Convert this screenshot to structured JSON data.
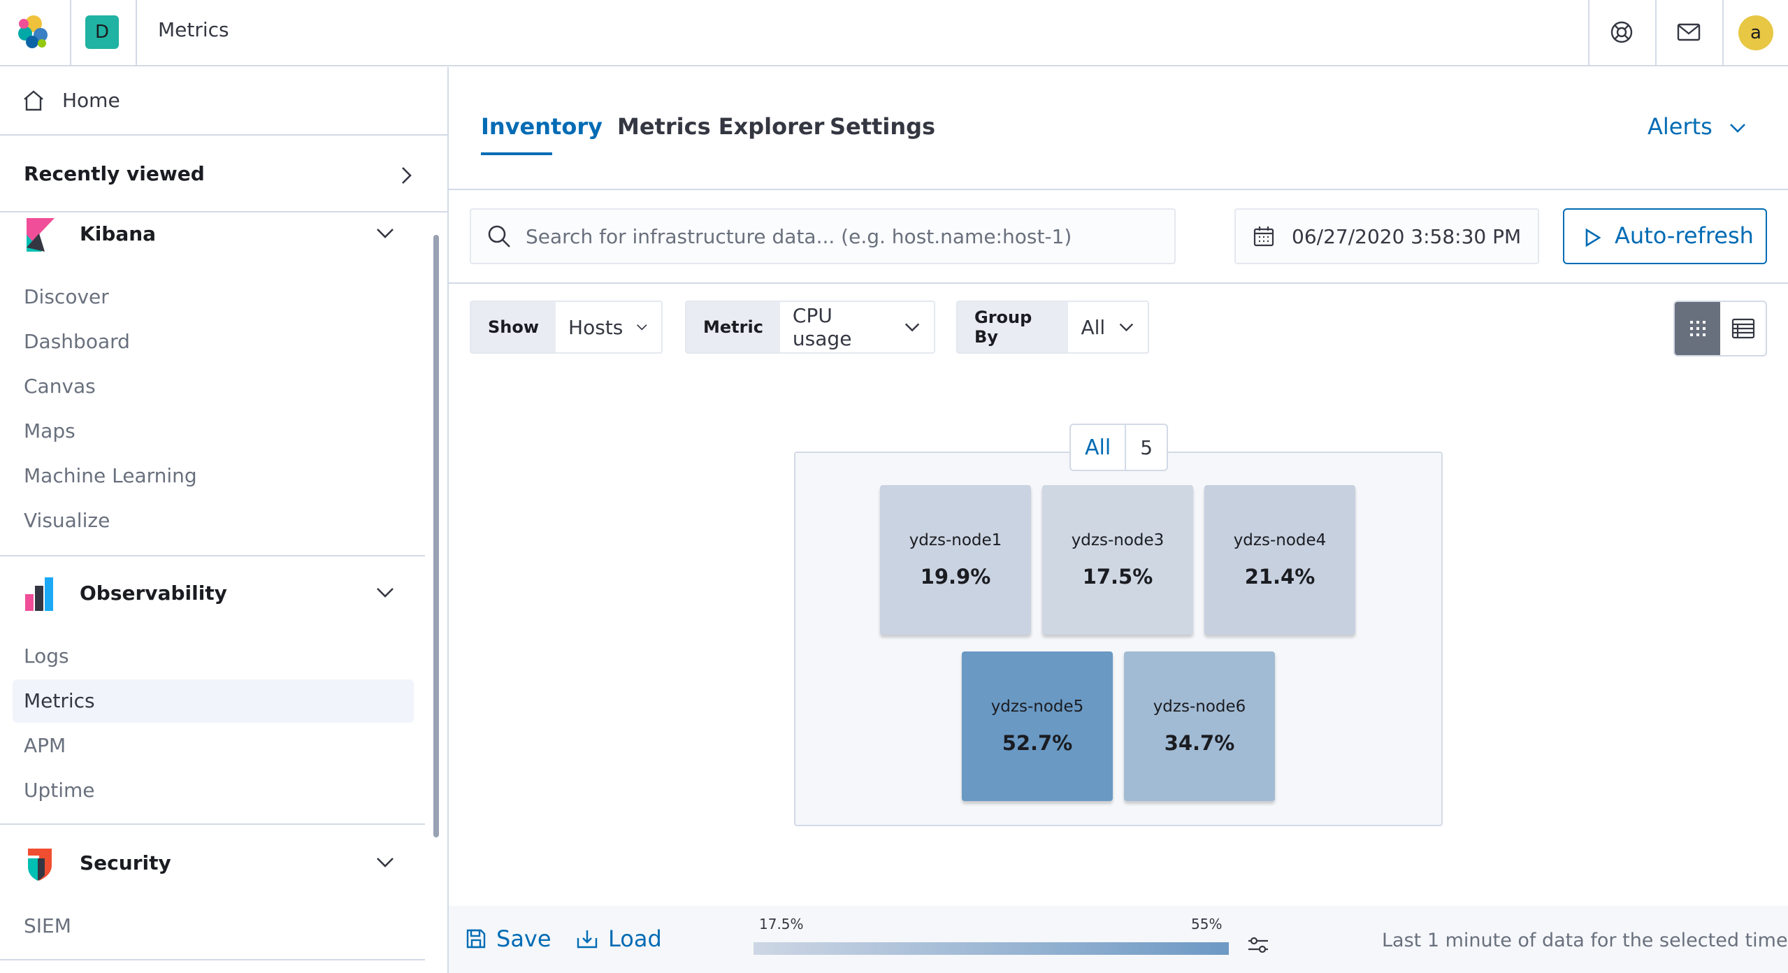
{
  "header": {
    "space_initial": "D",
    "breadcrumb": "Metrics",
    "user_initial": "a",
    "icons": [
      "elastic-logo",
      "help-icon",
      "newsfeed-icon"
    ]
  },
  "sidebar": {
    "home_label": "Home",
    "recently_viewed_label": "Recently viewed",
    "groups": [
      {
        "title": "Kibana",
        "items": [
          "Discover",
          "Dashboard",
          "Canvas",
          "Maps",
          "Machine Learning",
          "Visualize"
        ]
      },
      {
        "title": "Observability",
        "items": [
          "Logs",
          "Metrics",
          "APM",
          "Uptime"
        ],
        "active_item": "Metrics"
      },
      {
        "title": "Security",
        "items": [
          "SIEM"
        ]
      }
    ]
  },
  "main": {
    "tabs": [
      {
        "label": "Inventory",
        "active": true
      },
      {
        "label": "Metrics Explorer",
        "active": false
      },
      {
        "label": "Settings",
        "active": false
      }
    ],
    "alerts_label": "Alerts",
    "search_placeholder": "Search for infrastructure data... (e.g. host.name:host-1)",
    "date_value": "06/27/2020 3:58:30 PM",
    "auto_refresh_label": "Auto-refresh",
    "pickers": {
      "show": {
        "prefix": "Show",
        "value": "Hosts"
      },
      "metric": {
        "prefix": "Metric",
        "value": "CPU usage"
      },
      "group_by": {
        "prefix": "Group By",
        "value": "All"
      }
    },
    "view_mode": "map",
    "waffle": {
      "group_label": "All",
      "group_count": "5",
      "nodes": [
        {
          "name": "ydzs-node1",
          "value": "19.9%",
          "color": "#cad3e1"
        },
        {
          "name": "ydzs-node3",
          "value": "17.5%",
          "color": "#cfd7e3"
        },
        {
          "name": "ydzs-node4",
          "value": "21.4%",
          "color": "#c6d0df"
        },
        {
          "name": "ydzs-node5",
          "value": "52.7%",
          "color": "#6a99c4"
        },
        {
          "name": "ydzs-node6",
          "value": "34.7%",
          "color": "#a2bbd4"
        }
      ]
    },
    "footer": {
      "save_label": "Save",
      "load_label": "Load",
      "legend_min": "17.5%",
      "legend_max": "55%",
      "note": "Last 1 minute of data for the selected time"
    }
  },
  "colors": {
    "primary": "#006bb4",
    "border": "#d3dae6",
    "text": "#343741",
    "subdued": "#69707d"
  }
}
